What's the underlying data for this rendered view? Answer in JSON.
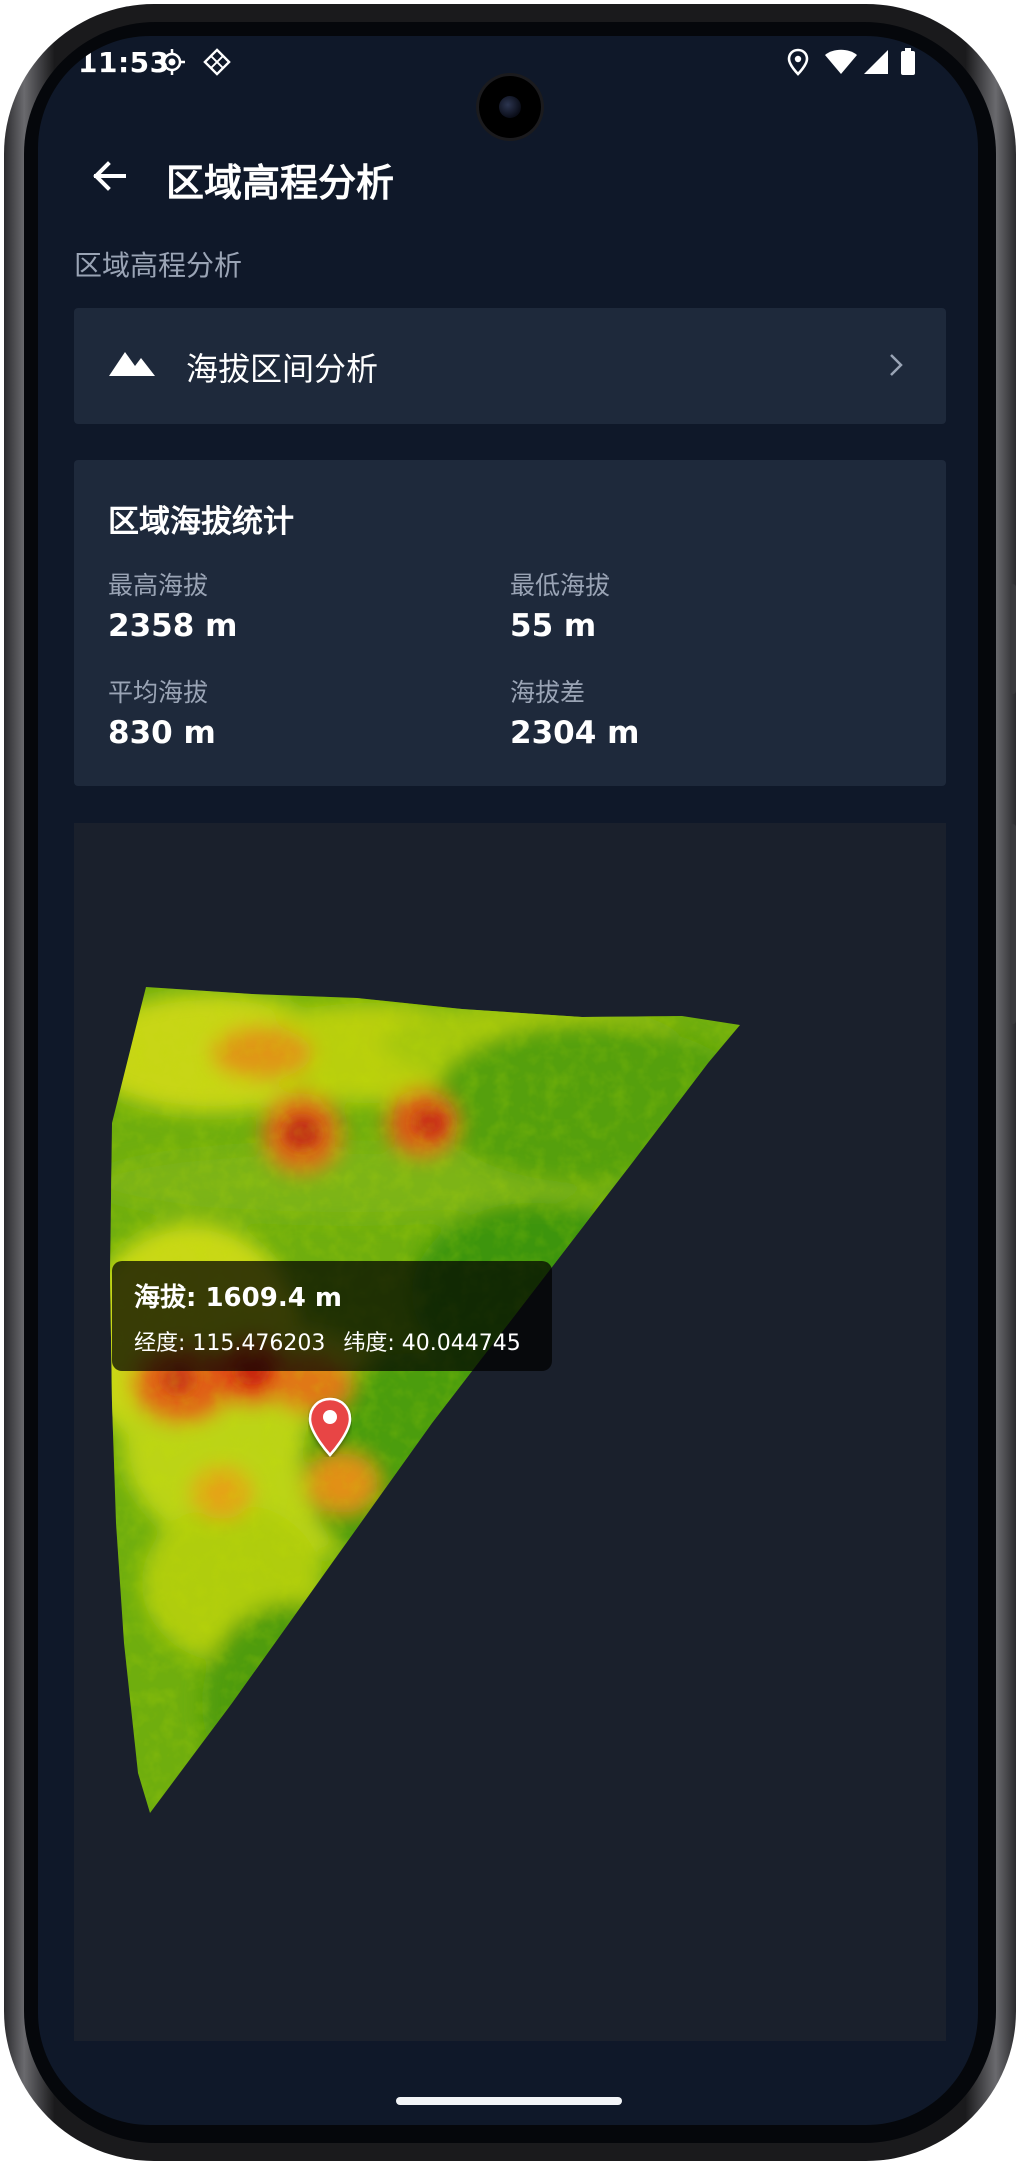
{
  "status_bar": {
    "time": "11:53"
  },
  "app_bar": {
    "back_icon": "arrow-back-icon",
    "title": "区域高程分析"
  },
  "section": {
    "label": "区域高程分析"
  },
  "menu": {
    "icon": "mountain-icon",
    "label": "海拔区间分析",
    "chevron_icon": "chevron-right-icon"
  },
  "stats": {
    "title": "区域海拔统计",
    "items": [
      {
        "label": "最高海拔",
        "value": "2358 m"
      },
      {
        "label": "最低海拔",
        "value": "55 m"
      },
      {
        "label": "平均海拔",
        "value": "830 m"
      },
      {
        "label": "海拔差",
        "value": "2304 m"
      }
    ]
  },
  "map": {
    "tooltip": {
      "elevation": "海拔: 1609.4 m",
      "longitude": "经度: 115.476203",
      "latitude": "纬度: 40.044745"
    },
    "marker_icon": "map-pin-icon"
  },
  "colors": {
    "background": "#0f1829",
    "card": "#1e293b",
    "map_panel": "#1a202c",
    "muted_text": "#9aa4b5",
    "marker": "#e84545"
  }
}
